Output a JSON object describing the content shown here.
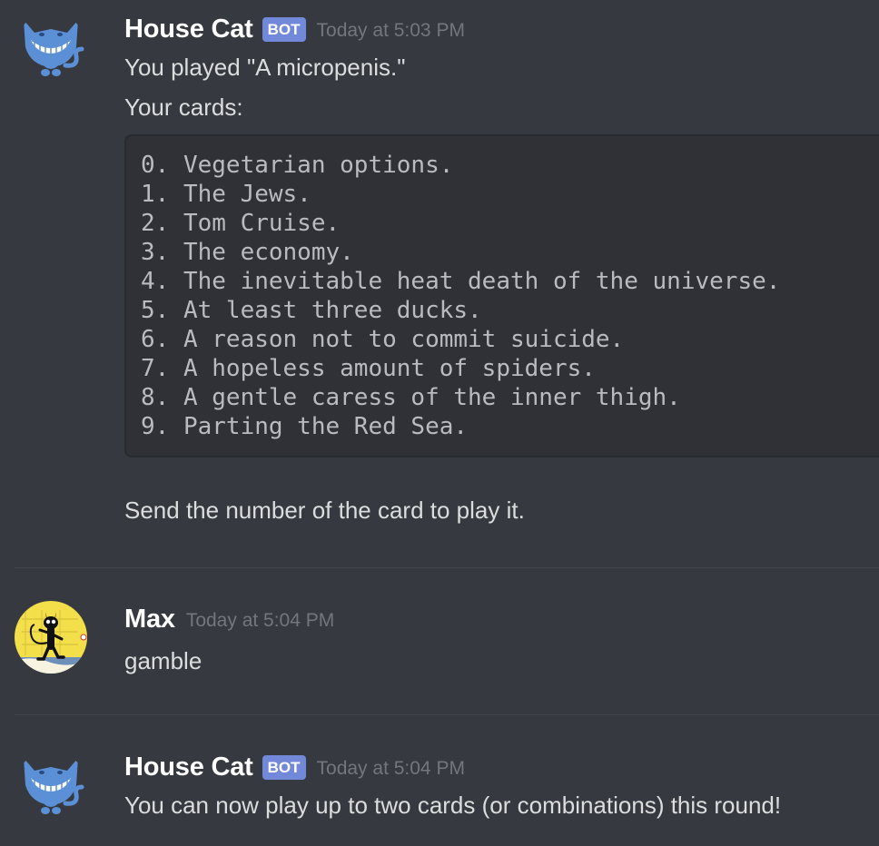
{
  "messages": [
    {
      "username": "House Cat",
      "bot_tag": "BOT",
      "timestamp": "Today at 5:03 PM",
      "lines": [
        "You played \"A micropenis.\"",
        "Your cards:"
      ],
      "code_lines": [
        "0. Vegetarian options.",
        "1. The Jews.",
        "2. Tom Cruise.",
        "3. The economy.",
        "4. The inevitable heat death of the universe.",
        "5. At least three ducks.",
        "6. A reason not to commit suicide.",
        "7. A hopeless amount of spiders.",
        "8. A gentle caress of the inner thigh.",
        "9. Parting the Red Sea."
      ],
      "footer": "Send the number of the card to play it."
    },
    {
      "username": "Max",
      "timestamp": "Today at 5:04 PM",
      "lines": [
        "gamble"
      ]
    },
    {
      "username": "House Cat",
      "bot_tag": "BOT",
      "timestamp": "Today at 5:04 PM",
      "lines": [
        "You can now play up to two cards (or combinations) this round!"
      ]
    }
  ],
  "colors": {
    "background": "#36393f",
    "bot_tag": "#7289da",
    "codeblock_bg": "#2f3136",
    "timestamp": "#72767d"
  },
  "icons": {
    "house_cat_avatar": "grinning-cat-icon",
    "max_avatar": "black-imp-cartoon-avatar"
  }
}
